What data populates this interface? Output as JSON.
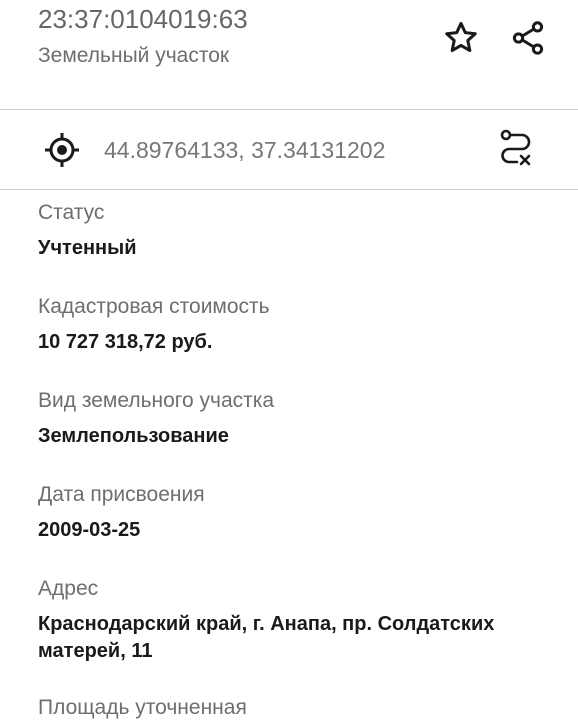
{
  "header": {
    "title": "23:37:0104019:63",
    "subtitle": "Земельный участок"
  },
  "icons": {
    "favorite": "star-outline-icon",
    "share": "share-icon",
    "location": "crosshair-target-icon",
    "route": "route-cancel-icon"
  },
  "coordinates": "44.89764133, 37.34131202",
  "fields": [
    {
      "label": "Статус",
      "value": "Учтенный"
    },
    {
      "label": "Кадастровая стоимость",
      "value": "10 727 318,72 руб."
    },
    {
      "label": "Вид земельного участка",
      "value": "Землепользование"
    },
    {
      "label": "Дата присвоения",
      "value": "2009-03-25"
    },
    {
      "label": "Адрес",
      "value": "Краснодарский край, г. Анапа, пр. Солдатских матерей, 11"
    },
    {
      "label": "Площадь уточненная",
      "value": ""
    }
  ]
}
